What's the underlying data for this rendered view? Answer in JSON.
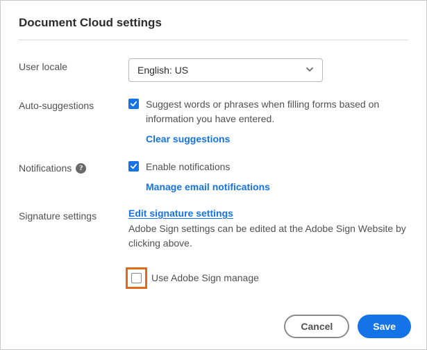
{
  "title": "Document Cloud settings",
  "locale": {
    "label": "User locale",
    "value": "English: US"
  },
  "autoSuggestions": {
    "label": "Auto-suggestions",
    "desc": "Suggest words or phrases when filling forms based on information you have entered.",
    "clearLink": "Clear suggestions"
  },
  "notifications": {
    "label": "Notifications",
    "enable": "Enable notifications",
    "manageLink": "Manage email notifications"
  },
  "signature": {
    "label": "Signature settings",
    "editLink": "Edit signature settings",
    "desc": "Adobe Sign settings can be edited at the Adobe Sign Website by clicking above.",
    "useAdobeSign": "Use Adobe Sign manage"
  },
  "footer": {
    "cancel": "Cancel",
    "save": "Save"
  }
}
